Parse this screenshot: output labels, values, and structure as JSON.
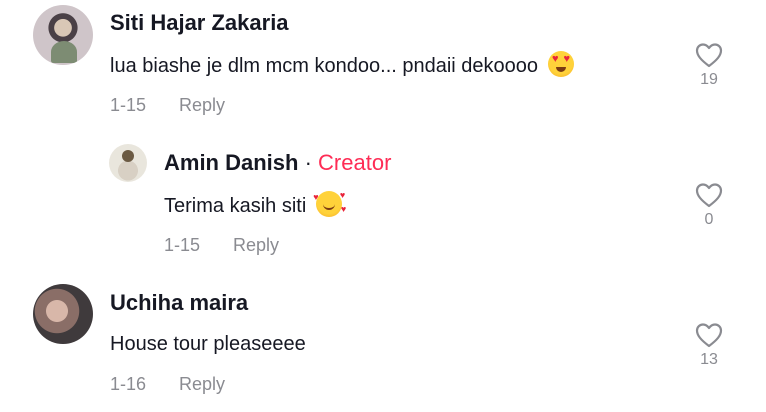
{
  "comments": [
    {
      "author": "Siti Hajar Zakaria",
      "text": "lua biashe je dlm mcm kondoo... pndaii dekoooo",
      "emoji": "heart-eyes-emoji",
      "date": "1-15",
      "reply_label": "Reply",
      "likes": "19"
    },
    {
      "author": "Amin Danish",
      "separator": "·",
      "badge": "Creator",
      "text": "Terima kasih siti",
      "emoji": "smiling-face-with-hearts-emoji",
      "date": "1-15",
      "reply_label": "Reply",
      "likes": "0"
    },
    {
      "author": "Uchiha maira",
      "text": "House tour pleaseeee",
      "date": "1-16",
      "reply_label": "Reply",
      "likes": "13"
    }
  ],
  "colors": {
    "text": "#161823",
    "muted": "#8a8b91",
    "creator_badge": "#fe2c55"
  }
}
